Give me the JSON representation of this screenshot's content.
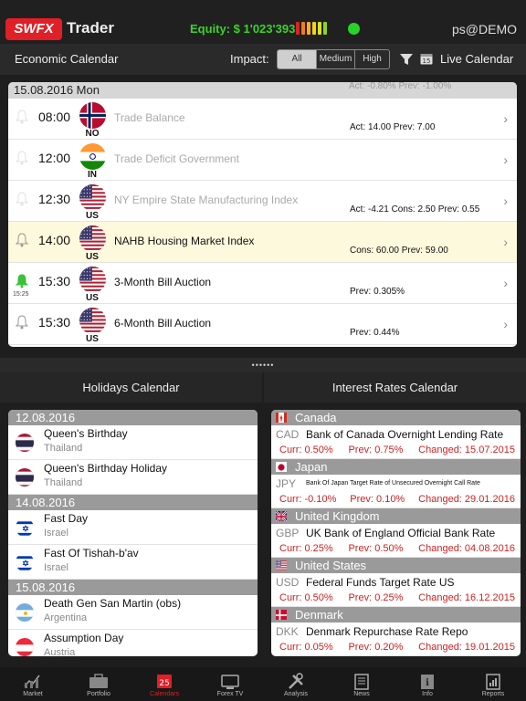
{
  "header": {
    "logo_text": "SWFX",
    "app_title": "Trader",
    "equity": "Equity: $ 1'023'393",
    "meter_colors": [
      "#e01f26",
      "#f07d1c",
      "#f6b01d",
      "#f6d21d",
      "#d9e41e",
      "#8fd324"
    ],
    "status_color": "#28d32a",
    "user": "ps@DEMO"
  },
  "subbar": {
    "title": "Economic Calendar",
    "impact_label": "Impact:",
    "impact_options": [
      "All",
      "Medium",
      "High"
    ],
    "impact_selected": "All",
    "live_label": "Live Calendar"
  },
  "economic": {
    "date_header": "15.08.2016 Mon",
    "ghost_text": "Act: -0.80%    Prev: -1.00%",
    "events": [
      {
        "time": "08:00",
        "country": "NO",
        "flag": "norway",
        "name": "Trade Balance",
        "values": "Act: 14.00    Prev: 7.00",
        "dim": true,
        "bell": "off",
        "alert_time": ""
      },
      {
        "time": "12:00",
        "country": "IN",
        "flag": "india",
        "name": "Trade Deficit Government",
        "values": "",
        "dim": true,
        "bell": "off",
        "alert_time": ""
      },
      {
        "time": "12:30",
        "country": "US",
        "flag": "us",
        "name": "NY Empire State Manufacturing Index",
        "values": "Act: -4.21    Cons: 2.50    Prev: 0.55",
        "dim": true,
        "bell": "off",
        "alert_time": ""
      },
      {
        "time": "14:00",
        "country": "US",
        "flag": "us",
        "name": "NAHB Housing Market Index",
        "values": "Cons: 60.00    Prev: 59.00",
        "dim": false,
        "bell": "outline",
        "alert_time": ""
      },
      {
        "time": "15:30",
        "country": "US",
        "flag": "us",
        "name": "3-Month Bill Auction",
        "values": "Prev: 0.305%",
        "dim": false,
        "bell": "green",
        "alert_time": "15:25"
      },
      {
        "time": "15:30",
        "country": "US",
        "flag": "us",
        "name": "6-Month Bill Auction",
        "values": "Prev: 0.44%",
        "dim": false,
        "bell": "outline",
        "alert_time": ""
      }
    ]
  },
  "splitter": "••••••",
  "holidays": {
    "title": "Holidays Calendar",
    "groups": [
      {
        "date": "12.08.2016",
        "items": [
          {
            "name": "Queen's Birthday",
            "country": "Thailand",
            "flag": "thailand"
          },
          {
            "name": "Queen's Birthday Holiday",
            "country": "Thailand",
            "flag": "thailand"
          }
        ]
      },
      {
        "date": "14.08.2016",
        "items": [
          {
            "name": "Fast Day",
            "country": "Israel",
            "flag": "israel"
          },
          {
            "name": "Fast Of Tishah-b'av",
            "country": "Israel",
            "flag": "israel"
          }
        ]
      },
      {
        "date": "15.08.2016",
        "items": [
          {
            "name": "Death Gen San Martin (obs)",
            "country": "Argentina",
            "flag": "argentina"
          },
          {
            "name": "Assumption Day",
            "country": "Austria",
            "flag": "austria"
          }
        ]
      }
    ]
  },
  "rates": {
    "title": "Interest Rates Calendar",
    "countries": [
      {
        "country": "Canada",
        "flag": "canada",
        "currency": "CAD",
        "name": "Bank of Canada Overnight Lending Rate",
        "small": false,
        "curr": "Curr: 0.50%",
        "prev": "Prev: 0.75%",
        "changed": "Changed: 15.07.2015"
      },
      {
        "country": "Japan",
        "flag": "japan",
        "currency": "JPY",
        "name": "Bank Of Japan Target Rate of Unsecured Overnight Call Rate",
        "small": true,
        "curr": "Curr: -0.10%",
        "prev": "Prev: 0.10%",
        "changed": "Changed: 29.01.2016"
      },
      {
        "country": "United Kingdom",
        "flag": "uk",
        "currency": "GBP",
        "name": "UK Bank of England Official Bank Rate",
        "small": false,
        "curr": "Curr: 0.25%",
        "prev": "Prev: 0.50%",
        "changed": "Changed: 04.08.2016"
      },
      {
        "country": "United States",
        "flag": "us",
        "currency": "USD",
        "name": "Federal Funds Target Rate US",
        "small": false,
        "curr": "Curr: 0.50%",
        "prev": "Prev: 0.25%",
        "changed": "Changed: 16.12.2015"
      },
      {
        "country": "Denmark",
        "flag": "denmark",
        "currency": "DKK",
        "name": "Denmark Repurchase Rate Repo",
        "small": false,
        "curr": "Curr: 0.05%",
        "prev": "Prev: 0.20%",
        "changed": "Changed: 19.01.2015"
      }
    ]
  },
  "tabs": [
    {
      "label": "Market",
      "icon": "chart-icon"
    },
    {
      "label": "Portfolio",
      "icon": "briefcase-icon"
    },
    {
      "label": "Calendars",
      "icon": "calendar-icon",
      "active": true
    },
    {
      "label": "Forex TV",
      "icon": "tv-icon"
    },
    {
      "label": "Analysis",
      "icon": "tools-icon"
    },
    {
      "label": "News",
      "icon": "news-icon"
    },
    {
      "label": "Info",
      "icon": "info-icon"
    },
    {
      "label": "Reports",
      "icon": "reports-icon"
    }
  ]
}
